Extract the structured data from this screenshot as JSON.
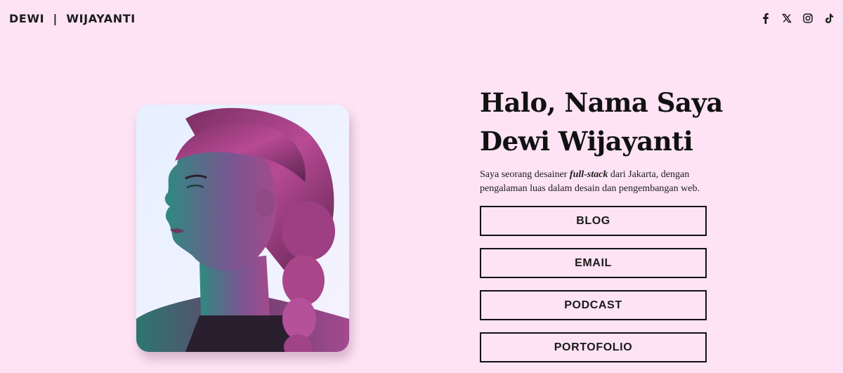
{
  "header": {
    "brand": "DEWI  |  WIJAYANTI",
    "socials": [
      {
        "icon": "facebook-icon"
      },
      {
        "icon": "x-twitter-icon"
      },
      {
        "icon": "instagram-icon"
      },
      {
        "icon": "tiktok-icon"
      }
    ]
  },
  "hero": {
    "title_line1": "Halo, Nama Saya",
    "title_line2": "Dewi Wijayanti",
    "intro_before": "Saya seorang desainer ",
    "intro_em": "full-stack",
    "intro_after": " dari Jakarta, dengan pengalaman luas dalam desain dan pengembangan web.",
    "photo_icon": "portrait-photo"
  },
  "buttons": {
    "blog": "BLOG",
    "email": "EMAIL",
    "podcast": "PODCAST",
    "portfolio": "PORTOFOLIO"
  },
  "colors": {
    "background": "#fde3f3",
    "text": "#111111",
    "photo_teal": "#2f8f86",
    "photo_magenta": "#b3408e"
  }
}
